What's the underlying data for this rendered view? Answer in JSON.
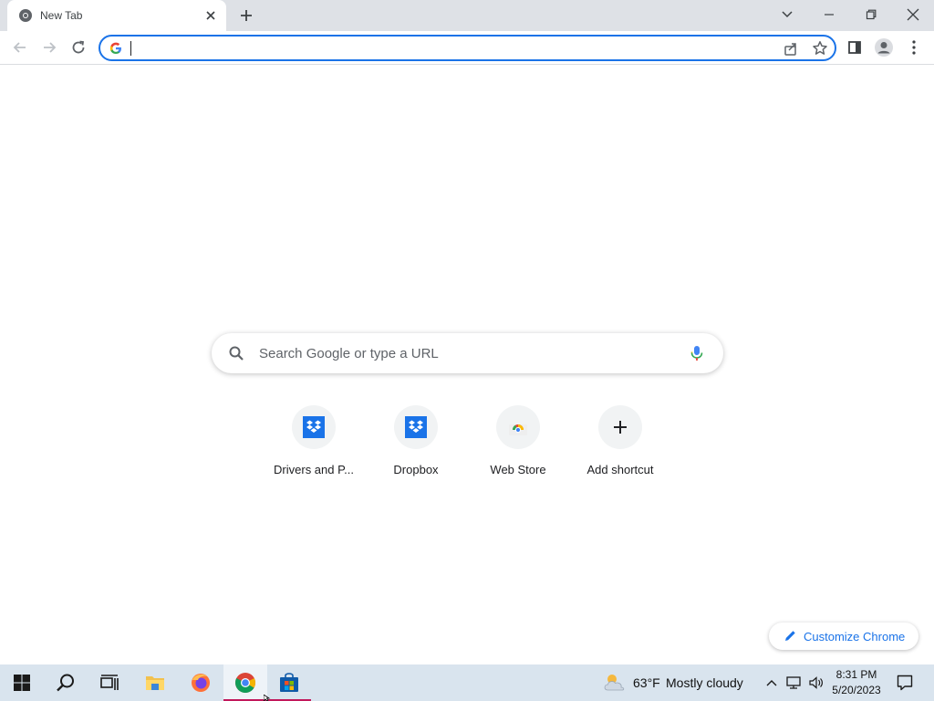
{
  "browser": {
    "tab_title": "New Tab",
    "omnibox_value": ""
  },
  "ntp": {
    "search_placeholder": "Search Google or type a URL",
    "shortcuts": [
      {
        "label": "Drivers and P...",
        "icon": "dropbox-icon"
      },
      {
        "label": "Dropbox",
        "icon": "dropbox-icon"
      },
      {
        "label": "Web Store",
        "icon": "web-store-icon"
      },
      {
        "label": "Add shortcut",
        "icon": "plus-icon"
      }
    ],
    "customize_label": "Customize Chrome"
  },
  "taskbar": {
    "weather_temp": "63°F",
    "weather_desc": "Mostly cloudy",
    "time": "8:31 PM",
    "date": "5/20/2023"
  },
  "colors": {
    "accent": "#1a73e8",
    "tabstrip": "#dee1e6",
    "taskbar": "#d9e4ee",
    "active_indicator": "#c2185b"
  }
}
